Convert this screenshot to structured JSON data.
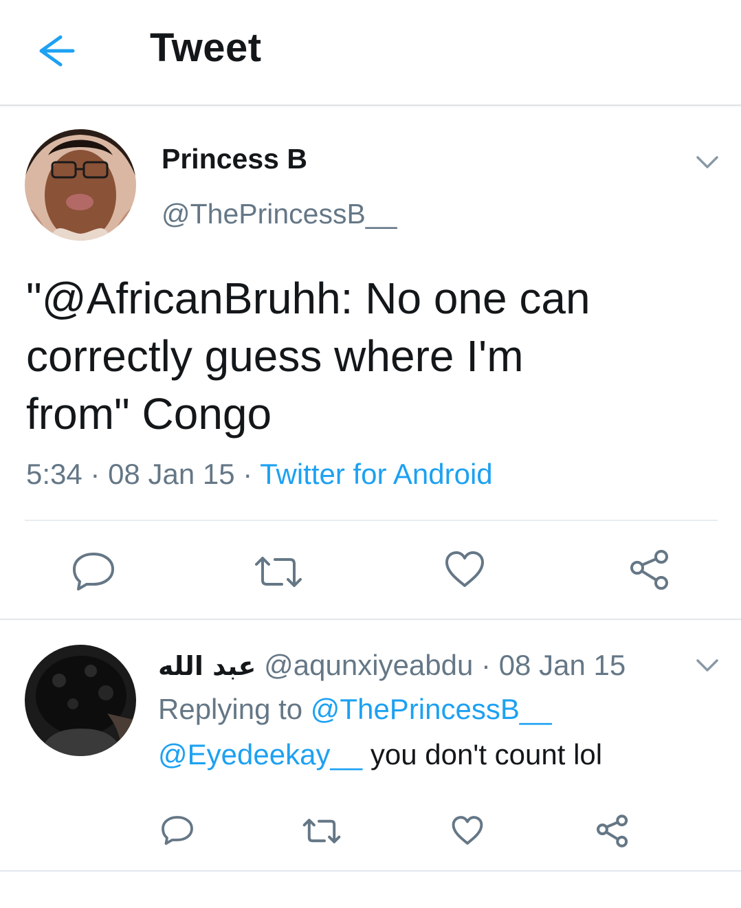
{
  "header": {
    "title": "Tweet",
    "back_icon": "arrow-left-icon"
  },
  "colors": {
    "accent": "#1da1f2",
    "secondary_text": "#657786",
    "primary_text": "#14171a",
    "divider": "#e1e8ed"
  },
  "tweet": {
    "display_name": "Princess B",
    "handle": "@ThePrincessB__",
    "text": "\"@AfricanBruhh: No one can\ncorrectly guess where I'm\nfrom\" Congo",
    "time": "5:34",
    "sep1": " · ",
    "date": "08 Jan 15",
    "sep2": " · ",
    "source": "Twitter for Android",
    "actions": [
      "reply-icon",
      "retweet-icon",
      "like-icon",
      "share-icon"
    ]
  },
  "reply": {
    "display_name": "عبد الله",
    "handle": "@aqunxiyeabdu",
    "sep": " · ",
    "date": "08 Jan 15",
    "replying_prefix": "Replying to ",
    "replying_to": "@ThePrincessB__",
    "mention": "@Eyedeekay__",
    "text": " you don't count lol",
    "actions": [
      "reply-icon",
      "retweet-icon",
      "like-icon",
      "share-icon"
    ]
  }
}
